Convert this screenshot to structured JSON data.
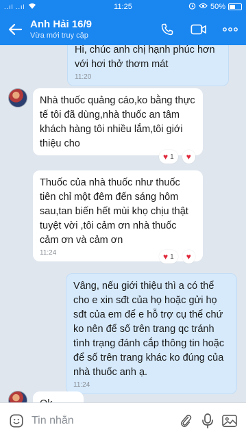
{
  "status_bar": {
    "signal_text": "..ıl ..ıl",
    "time": "11:25",
    "battery": "50%"
  },
  "header": {
    "contact_name": "Anh Hải 16/9",
    "contact_status": "Vừa mới truy cập",
    "icons": [
      "back-arrow-icon",
      "phone-icon",
      "video-call-icon",
      "more-icon"
    ]
  },
  "messages": [
    {
      "direction": "out",
      "text": "Hi, chúc anh chị hạnh phúc hơn với hơi thở thơm mát",
      "time": "11:20"
    },
    {
      "direction": "in",
      "text": "Nhà thuốc quảng cáo,ko bằng thực tế tôi đã dùng,nhà thuốc an tâm khách hàng tôi nhiều lắm,tôi giới thiệu cho",
      "time": "",
      "reaction_count": "1"
    },
    {
      "direction": "in",
      "text": "Thuốc của nhà thuốc như thuốc tiên chỉ một đêm đến sáng hôm sau,tan biến hết mùi khọ chịu thật tuyệt vời ,tôi cảm ơn nhà thuốc cảm ơn và cảm ơn",
      "time": "11:24",
      "reaction_count": "1"
    },
    {
      "direction": "out",
      "text": "Vâng, nếu giới thiệu thì a có thể cho e xin sđt của họ hoặc gửi họ sđt của em để e hỗ trợ cụ thể chứ ko nên để số trên trang qc tránh tình trạng đánh cắp thông tin hoặc để số trên trang khác ko đúng của nhà thuốc anh ạ.",
      "time": "11:24"
    },
    {
      "direction": "in",
      "text": "Ok",
      "time": ""
    }
  ],
  "input_bar": {
    "placeholder": "Tin nhắn",
    "icons": [
      "emoji-icon",
      "attachment-icon",
      "microphone-icon",
      "image-icon"
    ]
  },
  "colors": {
    "header_bg": "#1a86f0",
    "chat_bg": "#dfe6ee",
    "outgoing_bubble": "#d6eafc",
    "incoming_bubble": "#ffffff",
    "heart": "#e0283b"
  }
}
